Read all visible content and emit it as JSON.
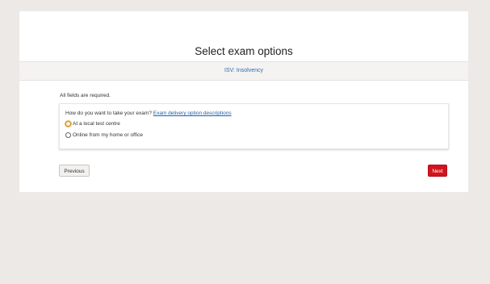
{
  "page": {
    "title": "Select exam options",
    "exam_name": "ISV: Insolvency",
    "required_note": "All fields are required."
  },
  "question": {
    "text": "How do you want to take your exam?",
    "link_label": "Exam delivery option descriptions",
    "options": [
      {
        "label": "At a local test centre",
        "focused": true
      },
      {
        "label": "Online from my home or office",
        "focused": false
      }
    ]
  },
  "navigation": {
    "previous_label": "Previous",
    "next_label": "Next"
  },
  "colors": {
    "background": "#ece9e6",
    "link": "#1f5fa8",
    "next_button": "#d2141e",
    "focus_ring": "#f2b53c"
  }
}
